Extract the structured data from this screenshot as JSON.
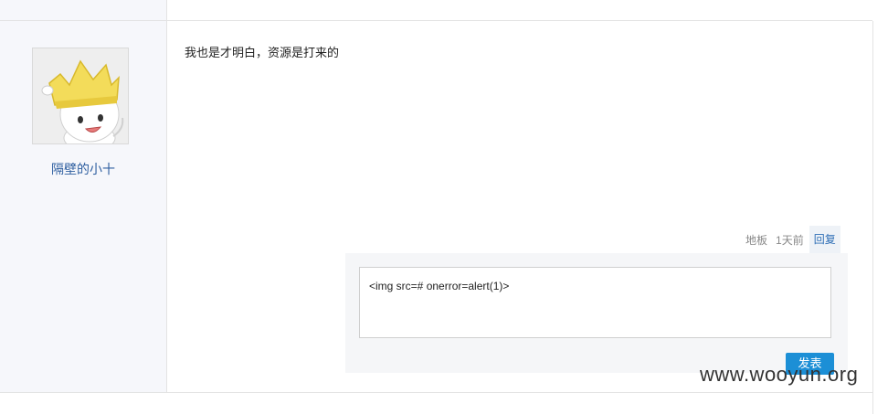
{
  "author": {
    "name": "隔壁的小十",
    "avatar_icon": "crown-character-avatar"
  },
  "post": {
    "content": "我也是才明白，资源是打来的",
    "floor_label": "地板",
    "time_label": "1天前",
    "reply_label": "回复"
  },
  "reply_box": {
    "value": "<img src=# onerror=alert(1)>",
    "submit_label": "发表"
  },
  "watermark": "www.wooyun.org",
  "colors": {
    "link": "#2f5fa0",
    "button": "#1c8fd6",
    "sidebar_bg": "#f6f7fb"
  }
}
